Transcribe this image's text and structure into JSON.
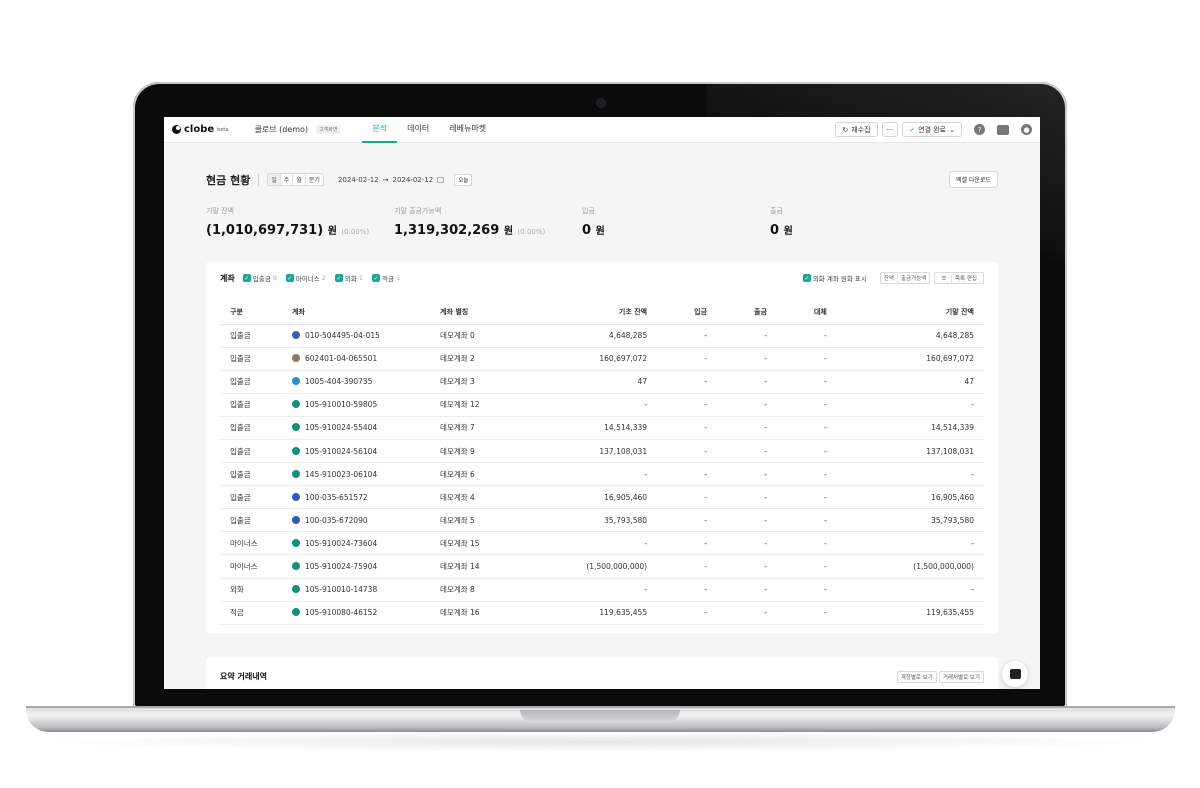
{
  "topbar": {
    "logo": "clobe",
    "logo_sup": "beta",
    "company": "클로브 (demo)",
    "tag": "고객화면",
    "nav": [
      "분석",
      "데이터",
      "레베뉴마켓"
    ],
    "active_nav": "분석",
    "refresh": "재수집",
    "more": "···",
    "connection": "연결 완료"
  },
  "header": {
    "title": "현금 현황",
    "periods": [
      "일",
      "주",
      "월",
      "분기"
    ],
    "date_from": "2024-02-12",
    "date_sep": "→",
    "date_to": "2024-02-12",
    "today": "오늘",
    "excel": "엑셀 다운로드"
  },
  "stats": [
    {
      "label": "기말 잔액",
      "value": "(1,010,697,731)",
      "unit": "원",
      "pct": "(0.00%)"
    },
    {
      "label": "기말 출금가능액",
      "value": "1,319,302,269",
      "unit": "원",
      "pct": "(0.00%)"
    },
    {
      "label": "입금",
      "value": "0",
      "unit": "원",
      "pct": ""
    },
    {
      "label": "출금",
      "value": "0",
      "unit": "원",
      "pct": ""
    }
  ],
  "accounts": {
    "title": "계좌",
    "filters": [
      {
        "label": "입출금",
        "count": "9"
      },
      {
        "label": "마이너스",
        "count": "2"
      },
      {
        "label": "외화",
        "count": "1"
      },
      {
        "label": "적금",
        "count": "1"
      }
    ],
    "fx_toggle": "외화 계좌 원화 표시",
    "view_options": [
      "잔액",
      "출금가능액"
    ],
    "edit_list": "목록 편집",
    "columns": [
      "구분",
      "계좌",
      "계좌 별칭",
      "기초 잔액",
      "입금",
      "출금",
      "대체",
      "기말 잔액"
    ],
    "rows": [
      {
        "type": "입출금",
        "account": "010-504495-04-015",
        "alias": "데모계좌 0",
        "opening": "4,648,285",
        "deposit": "-",
        "withdraw": "-",
        "transfer": "-",
        "closing": "4,648,285",
        "bank_color": "#3b5db3"
      },
      {
        "type": "입출금",
        "account": "602401-04-065501",
        "alias": "데모계좌 2",
        "opening": "160,697,072",
        "deposit": "-",
        "withdraw": "-",
        "transfer": "-",
        "closing": "160,697,072",
        "bank_color": "#8a7a55"
      },
      {
        "type": "입출금",
        "account": "1005-404-390735",
        "alias": "데모계좌 3",
        "opening": "47",
        "deposit": "-",
        "withdraw": "-",
        "transfer": "-",
        "closing": "47",
        "bank_color": "#2a8fd0"
      },
      {
        "type": "입출금",
        "account": "105-910010-59805",
        "alias": "데모계좌 12",
        "opening": "-",
        "deposit": "-",
        "withdraw": "-",
        "transfer": "-",
        "closing": "-",
        "bank_color": "#10927f"
      },
      {
        "type": "입출금",
        "account": "105-910024-55404",
        "alias": "데모계좌 7",
        "opening": "14,514,339",
        "deposit": "-",
        "withdraw": "-",
        "transfer": "-",
        "closing": "14,514,339",
        "bank_color": "#10927f"
      },
      {
        "type": "입출금",
        "account": "105-910024-56104",
        "alias": "데모계좌 9",
        "opening": "137,108,031",
        "deposit": "-",
        "withdraw": "-",
        "transfer": "-",
        "closing": "137,108,031",
        "bank_color": "#10927f"
      },
      {
        "type": "입출금",
        "account": "145-910023-06104",
        "alias": "데모계좌 6",
        "opening": "-",
        "deposit": "-",
        "withdraw": "-",
        "transfer": "-",
        "closing": "-",
        "bank_color": "#10927f"
      },
      {
        "type": "입출금",
        "account": "100-035-651572",
        "alias": "데모계좌 4",
        "opening": "16,905,460",
        "deposit": "-",
        "withdraw": "-",
        "transfer": "-",
        "closing": "16,905,460",
        "bank_color": "#2f59c4"
      },
      {
        "type": "입출금",
        "account": "100-035-672090",
        "alias": "데모계좌 5",
        "opening": "35,793,580",
        "deposit": "-",
        "withdraw": "-",
        "transfer": "-",
        "closing": "35,793,580",
        "bank_color": "#2f59c4"
      },
      {
        "type": "마이너스",
        "account": "105-910024-73604",
        "alias": "데모계좌 15",
        "opening": "-",
        "deposit": "-",
        "withdraw": "-",
        "transfer": "-",
        "closing": "-",
        "bank_color": "#10927f"
      },
      {
        "type": "마이너스",
        "account": "105-910024-75904",
        "alias": "데모계좌 14",
        "opening": "(1,500,000,000)",
        "deposit": "-",
        "withdraw": "-",
        "transfer": "-",
        "closing": "(1,500,000,000)",
        "bank_color": "#10927f"
      },
      {
        "type": "외화",
        "account": "105-910010-14738",
        "alias": "데모계좌 8",
        "opening": "-",
        "deposit": "-",
        "withdraw": "-",
        "transfer": "-",
        "closing": "-",
        "bank_color": "#10927f"
      },
      {
        "type": "적금",
        "account": "105-910080-46152",
        "alias": "데모계좌 16",
        "opening": "119,635,455",
        "deposit": "-",
        "withdraw": "-",
        "transfer": "-",
        "closing": "119,635,455",
        "bank_color": "#10927f"
      }
    ]
  },
  "summary": {
    "title": "요약 거래내역",
    "buttons": [
      "계정별로 보기",
      "거래처별로 보기"
    ]
  },
  "colors": {
    "accent": "#14a89a"
  }
}
